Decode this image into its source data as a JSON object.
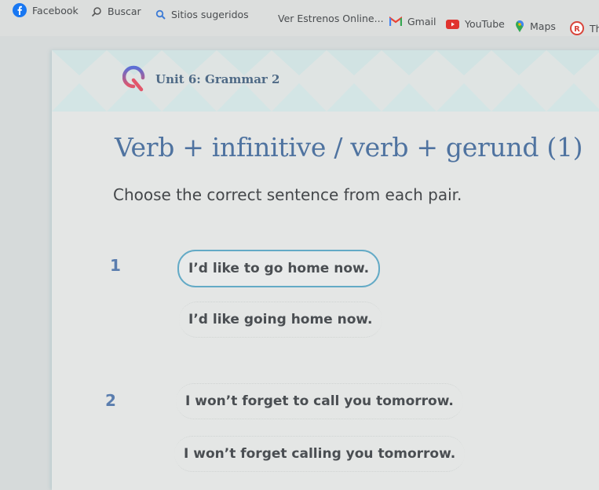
{
  "bookmarks": [
    {
      "label": "Facebook",
      "icon": "facebook-icon",
      "color": "#1877f2"
    },
    {
      "label": "Buscar",
      "icon": "search-icon",
      "color": "#555555"
    },
    {
      "label": "Sitios sugeridos",
      "icon": "search-icon",
      "color": "#3d7bd6"
    },
    {
      "label": "Ver Estrenos Online...",
      "icon": "",
      "color": ""
    },
    {
      "label": "Gmail",
      "icon": "gmail-icon",
      "color": "#ea4335"
    },
    {
      "label": "YouTube",
      "icon": "youtube-icon",
      "color": "#e0332e"
    },
    {
      "label": "Maps",
      "icon": "maps-icon",
      "color": "#34a853"
    },
    {
      "label": "Th",
      "icon": "r-icon",
      "color": "#d9443a"
    }
  ],
  "header": {
    "unit_title": "Unit 6: Grammar 2",
    "logo_colors": [
      "#5b6fd6",
      "#e2566a"
    ]
  },
  "exercise": {
    "title": "Verb + infinitive / verb + gerund (1)",
    "instruction": "Choose the correct sentence from each pair.",
    "questions": [
      {
        "number": "1",
        "options": [
          {
            "text": "I’d like to go home now.",
            "selected": true
          },
          {
            "text": "I’d like going home now.",
            "selected": false
          }
        ]
      },
      {
        "number": "2",
        "options": [
          {
            "text": "I won’t forget to call you tomorrow.",
            "selected": false
          },
          {
            "text": "I won’t forget calling you tomorrow.",
            "selected": false
          }
        ]
      }
    ]
  },
  "colors": {
    "accent_border": "#63aac6",
    "heading": "#4f73a0",
    "question_number": "#5a7dae"
  }
}
